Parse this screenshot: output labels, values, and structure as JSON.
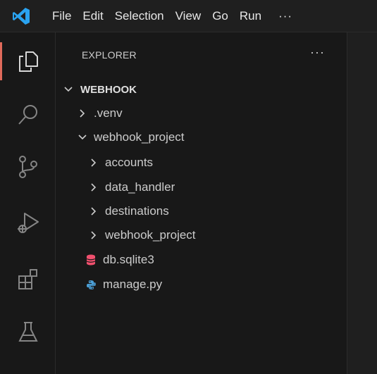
{
  "menu": [
    "File",
    "Edit",
    "Selection",
    "View",
    "Go",
    "Run"
  ],
  "menu_more": "···",
  "activity": [
    "explorer-icon",
    "search-icon",
    "source-control-icon",
    "run-debug-icon",
    "extensions-icon",
    "testing-icon"
  ],
  "explorer": {
    "title": "EXPLORER",
    "more": "···",
    "root": "WEBHOOK",
    "items": [
      {
        "label": ".venv",
        "type": "folder",
        "expanded": false
      },
      {
        "label": "webhook_project",
        "type": "folder",
        "expanded": true
      },
      {
        "label": "accounts",
        "type": "folder",
        "expanded": false
      },
      {
        "label": "data_handler",
        "type": "folder",
        "expanded": false
      },
      {
        "label": "destinations",
        "type": "folder",
        "expanded": false
      },
      {
        "label": "webhook_project",
        "type": "folder",
        "expanded": false
      },
      {
        "label": "db.sqlite3",
        "type": "file",
        "icon": "database-icon"
      },
      {
        "label": "manage.py",
        "type": "file",
        "icon": "python-icon"
      }
    ]
  },
  "colors": {
    "background": "#181818",
    "titlebar": "#1f1f1f",
    "vscode_blue": "#2aa3f0",
    "active_indicator": "#e06a5b",
    "sqlite_icon": "#f0506e",
    "python_icon": "#4b9fd6"
  }
}
